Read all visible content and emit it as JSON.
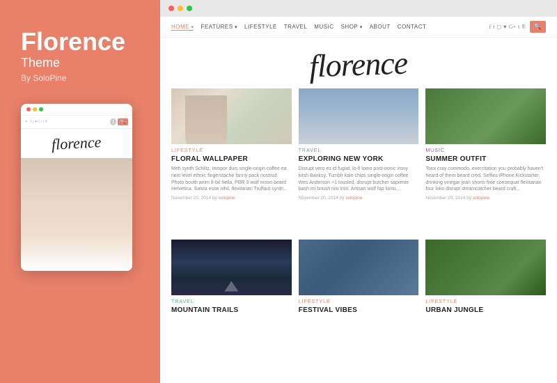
{
  "left": {
    "brand_title": "Florence",
    "brand_subtitle": "Theme",
    "brand_by": "By SoloPine",
    "mobile": {
      "logo_text": "florence",
      "dots": [
        "red",
        "yellow",
        "green"
      ]
    }
  },
  "browser": {
    "dots": [
      "red",
      "yellow",
      "green"
    ]
  },
  "site": {
    "logo_text": "florence",
    "nav": [
      {
        "label": "HOME",
        "active": true,
        "hasArrow": true
      },
      {
        "label": "FEATURES",
        "active": false,
        "hasArrow": true
      },
      {
        "label": "LIFESTYLE",
        "active": false,
        "hasArrow": false
      },
      {
        "label": "TRAVEL",
        "active": false,
        "hasArrow": false
      },
      {
        "label": "MUSIC",
        "active": false,
        "hasArrow": false
      },
      {
        "label": "SHOP",
        "active": false,
        "hasArrow": true
      },
      {
        "label": "ABOUT",
        "active": false,
        "hasArrow": false
      },
      {
        "label": "CONTACT",
        "active": false,
        "hasArrow": false
      }
    ]
  },
  "cards": [
    {
      "category": "LIFESTYLE",
      "category_class": "cat-lifestyle",
      "title": "FLORAL WALLPAPER",
      "excerpt": "Meh synth Schlitz, tempor duis single-origin coffee ea next level ethnic fingerstache fanny pack nostrud. Photo booth anim 8-bit hella, PBR 3 wolf moon beard Helvetica. Salvia esse nihil, flexitarian Truffaut synth...",
      "date": "November 20, 2014",
      "author": "solopine",
      "img_class": "img-floral"
    },
    {
      "category": "TRAVEL",
      "category_class": "cat-travel",
      "title": "EXPLORING NEW YORK",
      "excerpt": "Disrupt vero es id fugiat, lo-fi lomo post-ironic irony kitsh Banksy. Tumblr kale chips single-origin coffee Wes Anderson +1 tousled, disrupt butcher sapiente bash mi briush nisi irori. Artisan wolf fap lomo,...",
      "date": "November 20, 2014",
      "author": "solopine",
      "img_class": "img-ny"
    },
    {
      "category": "MUSIC",
      "category_class": "cat-music",
      "title": "SUMMER OUTFIT",
      "excerpt": "Tonx cray commodo, exercitation you probably haven't heard of them beard cred. Selfies iPhone Kickstarter, drinking vinegar jean shorts fixie consequat flexitarian four loko disrupt dreamcatcher beard craft...",
      "date": "November 20, 2014",
      "author": "solopine",
      "img_class": "img-outfit"
    },
    {
      "category": "TRAVEL",
      "category_class": "cat-travel",
      "title": "MOUNTAIN TRAILS",
      "excerpt": "",
      "date": "",
      "author": "",
      "img_class": "img-music"
    },
    {
      "category": "LIFESTYLE",
      "category_class": "cat-lifestyle",
      "title": "FESTIVAL VIBES",
      "excerpt": "",
      "date": "",
      "author": "",
      "img_class": "img-crowd"
    },
    {
      "category": "LIFESTYLE",
      "category_class": "cat-lifestyle",
      "title": "URBAN JUNGLE",
      "excerpt": "",
      "date": "",
      "author": "",
      "img_class": "img-plants"
    }
  ]
}
